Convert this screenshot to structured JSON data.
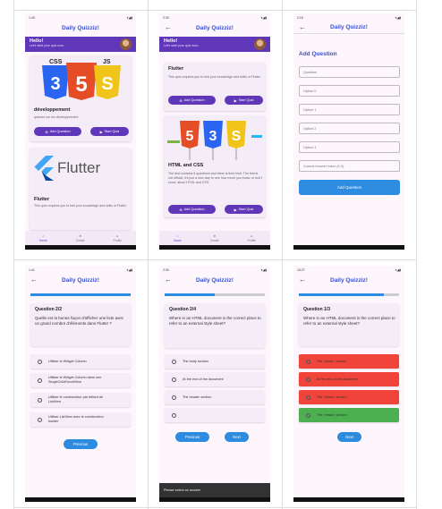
{
  "app_title": "Daily Quizziz!",
  "status_times": [
    "1:49",
    "2:30",
    "2:15",
    "1:41",
    "2:30",
    "10:27"
  ],
  "hello": {
    "title": "Hello!",
    "subtitle": "Let's start your quiz now..."
  },
  "cards": {
    "dev": {
      "title": "développement",
      "desc": "quizzes sur les développement"
    },
    "flutter": {
      "title": "Flutter",
      "desc": "This quiz requires you to test your knowledge and skills in Flutter.",
      "logo": "Flutter"
    },
    "html": {
      "title": "HTML and CSS",
      "desc": "The test contains 5 questions and there is time limit. The test is not official, it's just a nice way to see how much you know, or don't know, about HTML and CSS."
    }
  },
  "buttons": {
    "add_question": "Add Question",
    "start_quiz": "Start Quiz",
    "previous": "Previous",
    "next": "Next"
  },
  "nav": [
    "Home",
    "Create",
    "Profile"
  ],
  "add_form": {
    "title": "Add Question",
    "fields": [
      "Question",
      "Option 0",
      "Option 1",
      "Option 2",
      "Option 3",
      "Correct Answer Index (0-3)"
    ],
    "submit": "Add Question"
  },
  "q_french": {
    "title": "Question 2/2",
    "text": "Quelle est la bonne façon d'afficher une liste avec un grand nombre d'éléments dans Flutter ?",
    "options": [
      "Utiliser le Widget Column",
      "Utiliser le Widget Column dans une SingleChildScrollView",
      "Utiliser le constructeur par défaut de ListView",
      "Utiliser ListView avec le constructeur builder"
    ],
    "progress": 1.0
  },
  "q_html": {
    "title": "Question 2/4",
    "text": "Where in an HTML document is the correct place to refer to an external style sheet?",
    "options": [
      "The body section",
      "At the end of the document",
      "The header section",
      ""
    ],
    "snackbar": "Please select an answer",
    "progress": 0.5
  },
  "q_result": {
    "title": "Question 1/3",
    "text": "Where in an HTML document is the correct place to refer to an external style sheet?",
    "options": [
      "The <body> section",
      "At the end of the document",
      "The <head> section",
      "The <head> section"
    ],
    "option_colors": [
      "#f0443a",
      "#f0443a",
      "#f0443a",
      "#4caf50"
    ],
    "progress": 0.33
  },
  "colors": {
    "primary": "#5f37b8",
    "accent": "#2d8be0",
    "title": "#3a4fd0",
    "wrong": "#f0443a",
    "right": "#4caf50"
  }
}
